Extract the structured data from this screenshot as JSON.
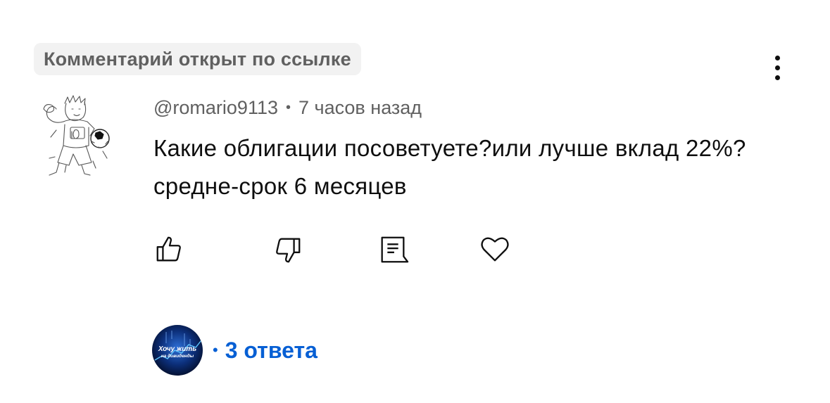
{
  "comment": {
    "pinned_label": "Комментарий открыт по ссылке",
    "author": "@romario9113",
    "separator": "•",
    "time": "7 часов назад",
    "text": "Какие облигации посоветуете?или лучше вклад 22%? средне-срок 6 месяцев",
    "actions": {
      "like_icon": "thumb-up-icon",
      "dislike_icon": "thumb-down-icon",
      "reply_icon": "comment-icon",
      "heart_icon": "heart-icon"
    },
    "menu_icon": "more-vertical-icon"
  },
  "replies": {
    "separator": "•",
    "label": "3 ответа",
    "avatar_text_line1": "Хочу жить",
    "avatar_text_line2": "на дивиденды"
  },
  "colors": {
    "link": "#065fd4",
    "secondary_text": "#606060",
    "badge_bg": "#f2f2f2"
  }
}
